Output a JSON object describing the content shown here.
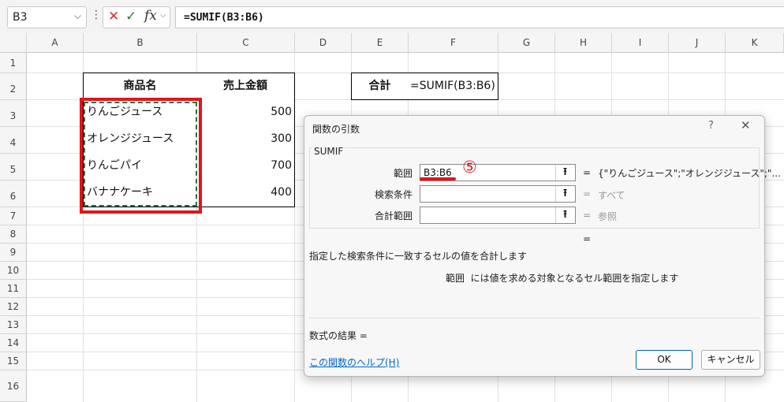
{
  "formula_bar": {
    "name_box": "B3",
    "formula": "=SUMIF(B3:B6)",
    "cancel_symbol": "✕",
    "enter_symbol": "✓",
    "fx_label": "fx"
  },
  "columns": [
    "A",
    "B",
    "C",
    "D",
    "E",
    "F",
    "G",
    "H",
    "I",
    "J",
    "K"
  ],
  "rows": [
    "1",
    "2",
    "3",
    "4",
    "5",
    "6",
    "7",
    "8",
    "9",
    "10",
    "11",
    "12",
    "13",
    "14",
    "15",
    "16"
  ],
  "table": {
    "header_name": "商品名",
    "header_sales": "売上金額",
    "items": [
      {
        "name": "りんごジュース",
        "amount": "500"
      },
      {
        "name": "オレンジジュース",
        "amount": "300"
      },
      {
        "name": "りんごパイ",
        "amount": "700"
      },
      {
        "name": "バナナケーキ",
        "amount": "400"
      }
    ]
  },
  "total": {
    "label": "合計",
    "formula": "=SUMIF(B3:B6)"
  },
  "dialog": {
    "title": "関数の引数",
    "help_symbol": "?",
    "close_symbol": "✕",
    "function_name": "SUMIF",
    "args": [
      {
        "label": "範囲",
        "value": "B3:B6",
        "eq": "=",
        "result": "{\"りんごジュース\";\"オレンジジュース\";\"..."
      },
      {
        "label": "検索条件",
        "value": "",
        "eq": "=",
        "result": "すべて"
      },
      {
        "label": "合計範囲",
        "value": "",
        "eq": "=",
        "result": "参照"
      }
    ],
    "formula_eq": "=",
    "description": "指定した検索条件に一致するセルの値を合計します",
    "arg_name": "範囲",
    "arg_description": "には値を求める対象となるセル範囲を指定します",
    "result_label": "数式の結果 =",
    "help_link": "この関数のヘルプ(H)",
    "ok_label": "OK",
    "cancel_label": "キャンセル"
  },
  "annotation": {
    "step_marker": "⑤"
  },
  "colors": {
    "highlight_red": "#e0141c",
    "marquee_green": "#217346",
    "link_blue": "#0066cc"
  }
}
